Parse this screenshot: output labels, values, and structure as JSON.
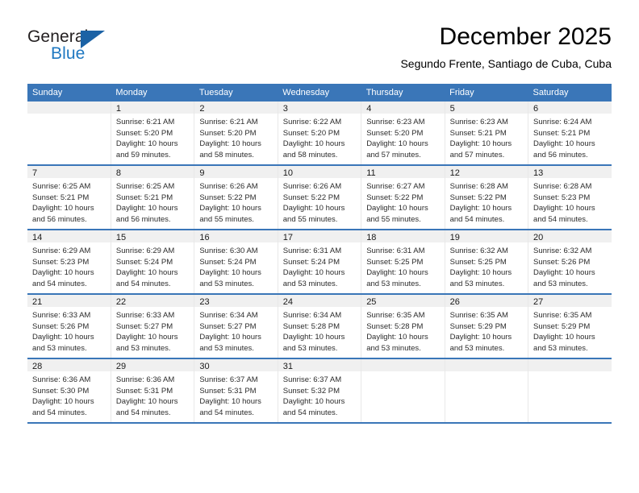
{
  "brand": {
    "name_part1": "General",
    "name_part2": "Blue",
    "triangle_color": "#1b62a5",
    "blue_color": "#1f78c1"
  },
  "header": {
    "title": "December 2025",
    "subtitle": "Segundo Frente, Santiago de Cuba, Cuba"
  },
  "theme": {
    "header_band": "#3a76b8",
    "daynum_bar": "#f0f0f0",
    "column_rule": "#e8e8e8"
  },
  "weekday_headers": [
    "Sunday",
    "Monday",
    "Tuesday",
    "Wednesday",
    "Thursday",
    "Friday",
    "Saturday"
  ],
  "weeks": [
    [
      {
        "day": "",
        "lines": []
      },
      {
        "day": "1",
        "lines": [
          "Sunrise: 6:21 AM",
          "Sunset: 5:20 PM",
          "Daylight: 10 hours",
          "and 59 minutes."
        ]
      },
      {
        "day": "2",
        "lines": [
          "Sunrise: 6:21 AM",
          "Sunset: 5:20 PM",
          "Daylight: 10 hours",
          "and 58 minutes."
        ]
      },
      {
        "day": "3",
        "lines": [
          "Sunrise: 6:22 AM",
          "Sunset: 5:20 PM",
          "Daylight: 10 hours",
          "and 58 minutes."
        ]
      },
      {
        "day": "4",
        "lines": [
          "Sunrise: 6:23 AM",
          "Sunset: 5:20 PM",
          "Daylight: 10 hours",
          "and 57 minutes."
        ]
      },
      {
        "day": "5",
        "lines": [
          "Sunrise: 6:23 AM",
          "Sunset: 5:21 PM",
          "Daylight: 10 hours",
          "and 57 minutes."
        ]
      },
      {
        "day": "6",
        "lines": [
          "Sunrise: 6:24 AM",
          "Sunset: 5:21 PM",
          "Daylight: 10 hours",
          "and 56 minutes."
        ]
      }
    ],
    [
      {
        "day": "7",
        "lines": [
          "Sunrise: 6:25 AM",
          "Sunset: 5:21 PM",
          "Daylight: 10 hours",
          "and 56 minutes."
        ]
      },
      {
        "day": "8",
        "lines": [
          "Sunrise: 6:25 AM",
          "Sunset: 5:21 PM",
          "Daylight: 10 hours",
          "and 56 minutes."
        ]
      },
      {
        "day": "9",
        "lines": [
          "Sunrise: 6:26 AM",
          "Sunset: 5:22 PM",
          "Daylight: 10 hours",
          "and 55 minutes."
        ]
      },
      {
        "day": "10",
        "lines": [
          "Sunrise: 6:26 AM",
          "Sunset: 5:22 PM",
          "Daylight: 10 hours",
          "and 55 minutes."
        ]
      },
      {
        "day": "11",
        "lines": [
          "Sunrise: 6:27 AM",
          "Sunset: 5:22 PM",
          "Daylight: 10 hours",
          "and 55 minutes."
        ]
      },
      {
        "day": "12",
        "lines": [
          "Sunrise: 6:28 AM",
          "Sunset: 5:22 PM",
          "Daylight: 10 hours",
          "and 54 minutes."
        ]
      },
      {
        "day": "13",
        "lines": [
          "Sunrise: 6:28 AM",
          "Sunset: 5:23 PM",
          "Daylight: 10 hours",
          "and 54 minutes."
        ]
      }
    ],
    [
      {
        "day": "14",
        "lines": [
          "Sunrise: 6:29 AM",
          "Sunset: 5:23 PM",
          "Daylight: 10 hours",
          "and 54 minutes."
        ]
      },
      {
        "day": "15",
        "lines": [
          "Sunrise: 6:29 AM",
          "Sunset: 5:24 PM",
          "Daylight: 10 hours",
          "and 54 minutes."
        ]
      },
      {
        "day": "16",
        "lines": [
          "Sunrise: 6:30 AM",
          "Sunset: 5:24 PM",
          "Daylight: 10 hours",
          "and 53 minutes."
        ]
      },
      {
        "day": "17",
        "lines": [
          "Sunrise: 6:31 AM",
          "Sunset: 5:24 PM",
          "Daylight: 10 hours",
          "and 53 minutes."
        ]
      },
      {
        "day": "18",
        "lines": [
          "Sunrise: 6:31 AM",
          "Sunset: 5:25 PM",
          "Daylight: 10 hours",
          "and 53 minutes."
        ]
      },
      {
        "day": "19",
        "lines": [
          "Sunrise: 6:32 AM",
          "Sunset: 5:25 PM",
          "Daylight: 10 hours",
          "and 53 minutes."
        ]
      },
      {
        "day": "20",
        "lines": [
          "Sunrise: 6:32 AM",
          "Sunset: 5:26 PM",
          "Daylight: 10 hours",
          "and 53 minutes."
        ]
      }
    ],
    [
      {
        "day": "21",
        "lines": [
          "Sunrise: 6:33 AM",
          "Sunset: 5:26 PM",
          "Daylight: 10 hours",
          "and 53 minutes."
        ]
      },
      {
        "day": "22",
        "lines": [
          "Sunrise: 6:33 AM",
          "Sunset: 5:27 PM",
          "Daylight: 10 hours",
          "and 53 minutes."
        ]
      },
      {
        "day": "23",
        "lines": [
          "Sunrise: 6:34 AM",
          "Sunset: 5:27 PM",
          "Daylight: 10 hours",
          "and 53 minutes."
        ]
      },
      {
        "day": "24",
        "lines": [
          "Sunrise: 6:34 AM",
          "Sunset: 5:28 PM",
          "Daylight: 10 hours",
          "and 53 minutes."
        ]
      },
      {
        "day": "25",
        "lines": [
          "Sunrise: 6:35 AM",
          "Sunset: 5:28 PM",
          "Daylight: 10 hours",
          "and 53 minutes."
        ]
      },
      {
        "day": "26",
        "lines": [
          "Sunrise: 6:35 AM",
          "Sunset: 5:29 PM",
          "Daylight: 10 hours",
          "and 53 minutes."
        ]
      },
      {
        "day": "27",
        "lines": [
          "Sunrise: 6:35 AM",
          "Sunset: 5:29 PM",
          "Daylight: 10 hours",
          "and 53 minutes."
        ]
      }
    ],
    [
      {
        "day": "28",
        "lines": [
          "Sunrise: 6:36 AM",
          "Sunset: 5:30 PM",
          "Daylight: 10 hours",
          "and 54 minutes."
        ]
      },
      {
        "day": "29",
        "lines": [
          "Sunrise: 6:36 AM",
          "Sunset: 5:31 PM",
          "Daylight: 10 hours",
          "and 54 minutes."
        ]
      },
      {
        "day": "30",
        "lines": [
          "Sunrise: 6:37 AM",
          "Sunset: 5:31 PM",
          "Daylight: 10 hours",
          "and 54 minutes."
        ]
      },
      {
        "day": "31",
        "lines": [
          "Sunrise: 6:37 AM",
          "Sunset: 5:32 PM",
          "Daylight: 10 hours",
          "and 54 minutes."
        ]
      },
      {
        "day": "",
        "lines": []
      },
      {
        "day": "",
        "lines": []
      },
      {
        "day": "",
        "lines": []
      }
    ]
  ]
}
